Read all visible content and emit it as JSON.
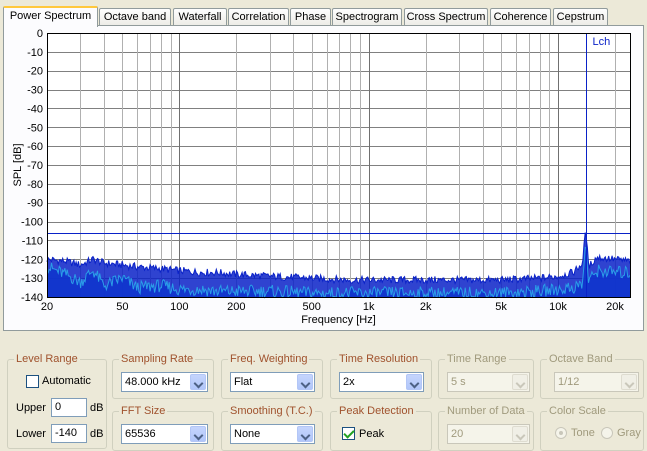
{
  "tabs": [
    "Power Spectrum",
    "Octave band",
    "Waterfall",
    "Correlation",
    "Phase",
    "Spectrogram",
    "Cross Spectrum",
    "Coherence",
    "Cepstrum"
  ],
  "active_tab": "Power Spectrum",
  "chart_data": {
    "type": "line",
    "ylabel": "SPL [dB]",
    "xlabel": "Frequency [Hz]",
    "xscale": "log",
    "xlim": [
      20,
      24000
    ],
    "ylim": [
      -140,
      0
    ],
    "yticks": [
      0,
      -10,
      -20,
      -30,
      -40,
      -50,
      -60,
      -70,
      -80,
      -90,
      -100,
      -110,
      -120,
      -130,
      -140
    ],
    "xticks": [
      {
        "value": 20,
        "label": "20"
      },
      {
        "value": 50,
        "label": "50"
      },
      {
        "value": 100,
        "label": "100"
      },
      {
        "value": 200,
        "label": "200"
      },
      {
        "value": 500,
        "label": "500"
      },
      {
        "value": 1000,
        "label": "1k"
      },
      {
        "value": 2000,
        "label": "2k"
      },
      {
        "value": 5000,
        "label": "5k"
      },
      {
        "value": 10000,
        "label": "10k"
      },
      {
        "value": 20000,
        "label": "20k"
      }
    ],
    "grid": true,
    "marker": {
      "label": "Lch",
      "frequency": 14000,
      "level_db": -106,
      "color": "#0a22c8"
    },
    "series": [
      {
        "color": "#0a22c8",
        "x": [
          20,
          25,
          30,
          35,
          40,
          50,
          60,
          80,
          100,
          130,
          160,
          200,
          300,
          500,
          800,
          1000,
          1500,
          2000,
          3000,
          5000,
          8000,
          10000,
          12000,
          13500,
          14000,
          14500,
          16000,
          20000,
          24000
        ],
        "y": [
          -120,
          -121,
          -123,
          -120,
          -122,
          -123,
          -124,
          -125,
          -126,
          -127,
          -127,
          -128,
          -129,
          -130,
          -131,
          -131,
          -131,
          -131,
          -131,
          -131,
          -130,
          -129,
          -127,
          -122,
          -103,
          -124,
          -119,
          -120,
          -121
        ]
      },
      {
        "color": "#2a9ee8",
        "x": [
          20,
          25,
          30,
          35,
          40,
          50,
          60,
          80,
          100,
          130,
          160,
          200,
          300,
          500,
          800,
          1000,
          1500,
          2000,
          3000,
          5000,
          8000,
          10000,
          12000,
          13500,
          14000,
          14500,
          16000,
          20000,
          24000
        ],
        "y": [
          -124,
          -128,
          -132,
          -126,
          -134,
          -130,
          -135,
          -134,
          -136,
          -136,
          -137,
          -137,
          -137,
          -138,
          -138,
          -138,
          -138,
          -138,
          -138,
          -138,
          -137,
          -136,
          -135,
          -133,
          -110,
          -132,
          -126,
          -127,
          -127
        ]
      }
    ]
  },
  "controls": {
    "level_range": {
      "title": "Level Range",
      "automatic_label": "Automatic",
      "automatic_checked": false,
      "upper_label": "Upper",
      "upper_value": "0",
      "lower_label": "Lower",
      "lower_value": "-140",
      "unit": "dB"
    },
    "sampling_rate": {
      "title": "Sampling Rate",
      "value": "48.000 kHz"
    },
    "freq_weighting": {
      "title": "Freq. Weighting",
      "value": "Flat"
    },
    "time_resolution": {
      "title": "Time Resolution",
      "value": "2x"
    },
    "time_range": {
      "title": "Time Range",
      "value": "5 s"
    },
    "octave_band": {
      "title": "Octave Band",
      "value": "1/12"
    },
    "fft_size": {
      "title": "FFT Size",
      "value": "65536"
    },
    "smoothing": {
      "title": "Smoothing (T.C.)",
      "value": "None"
    },
    "peak_detection": {
      "title": "Peak Detection",
      "peak_label": "Peak",
      "peak_checked": true
    },
    "number_of_data": {
      "title": "Number of Data",
      "value": "20"
    },
    "color_scale": {
      "title": "Color Scale",
      "tone_label": "Tone",
      "gray_label": "Gray"
    }
  }
}
